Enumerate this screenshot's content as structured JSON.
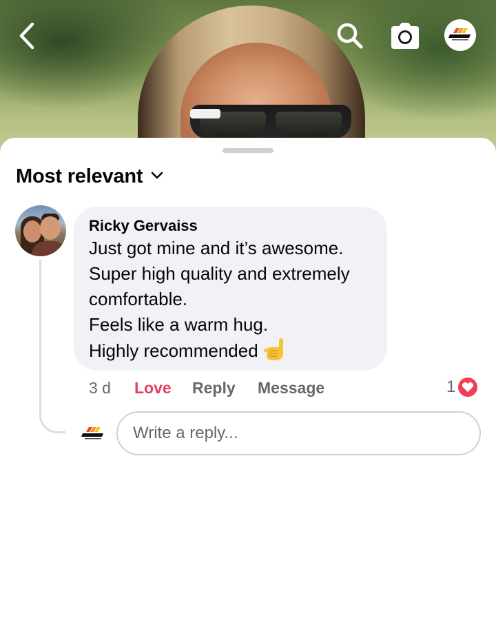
{
  "header": {
    "back_icon": "chevron-left-icon",
    "search_icon": "search-icon",
    "camera_icon": "camera-icon",
    "brand_logo": "thrilla-logo"
  },
  "comments": {
    "sort_label": "Most relevant",
    "sort_icon": "chevron-down-icon",
    "items": [
      {
        "author": "Ricky Gervaiss",
        "text_lines": [
          "Just got mine and it’s awesome.",
          "Super high quality and extremely",
          "comfortable.",
          "Feels like a warm hug.",
          "Highly recommended"
        ],
        "emoji": "call-me-hand",
        "time": "3 d",
        "love_label": "Love",
        "reply_label": "Reply",
        "message_label": "Message",
        "reaction_count": "1",
        "reaction_type": "heart",
        "reaction_color": "#f33e58"
      }
    ]
  },
  "reply_box": {
    "placeholder": "Write a reply..."
  },
  "colors": {
    "love": "#e4405f",
    "bubble": "#f0f2f5",
    "secondary_text": "#65676b"
  }
}
